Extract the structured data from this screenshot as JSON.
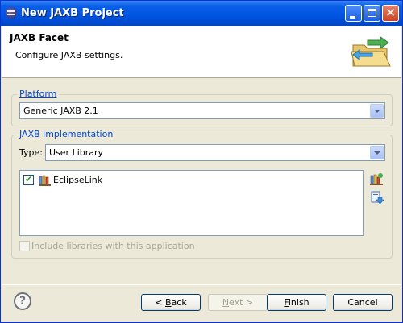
{
  "window": {
    "title": "New JAXB Project"
  },
  "titlebar_buttons": {
    "minimize": "minimize-icon",
    "maximize": "maximize-icon",
    "close": "close-icon",
    "close_glyph": "✕"
  },
  "banner": {
    "title": "JAXB Facet",
    "subtitle": "Configure JAXB settings.",
    "icon": "folder-arrow-icon"
  },
  "platform": {
    "legend": "Platform",
    "selected": "Generic JAXB 2.1"
  },
  "implementation": {
    "legend": "JAXB implementation",
    "type_label": "Type:",
    "type_selected": "User Library",
    "libraries": [
      {
        "name": "EclipseLink",
        "checked": true,
        "icon": "library-books-icon"
      }
    ],
    "manage_icon": "manage-libraries-icon",
    "download_icon": "download-library-icon",
    "include_label": "Include libraries with this application",
    "include_checked": false,
    "include_enabled": false
  },
  "footer": {
    "help": "?",
    "back_mnemonic": "B",
    "back_rest": "ack",
    "back_prefix": "< ",
    "next_mnemonic": "N",
    "next_rest": "ext >",
    "finish_mnemonic": "F",
    "finish_rest": "inish",
    "cancel": "Cancel"
  },
  "colors": {
    "titlebar": "#0054e3",
    "legend": "#0046d5",
    "dialog_bg": "#ece9d8"
  }
}
